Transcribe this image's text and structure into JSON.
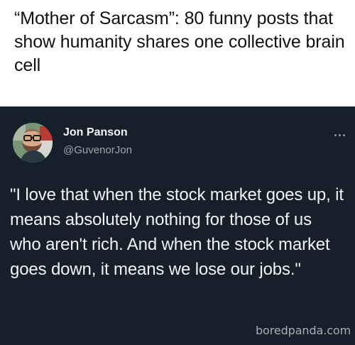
{
  "article": {
    "headline": "“Mother of Sarcasm”: 80 funny posts that show humanity shares one collective brain cell"
  },
  "tweet": {
    "author": {
      "display_name": "Jon Panson",
      "handle": "@GuvenorJon",
      "avatar_icon": "profile-photo"
    },
    "more_icon": "more-options-icon",
    "text": "\"I love that when the stock market goes up, it means absolutely nothing for those of us who aren't rich. And when the stock market goes down, it means we lose our jobs.\""
  },
  "watermark": {
    "text": "boredpanda.com"
  },
  "colors": {
    "page_background": "#ffffff",
    "headline_text": "#111111",
    "tweet_background": "#15202b",
    "tweet_text": "#f1f3f4",
    "secondary_text": "#9da5ad",
    "watermark_text": "#c8cdd2"
  }
}
